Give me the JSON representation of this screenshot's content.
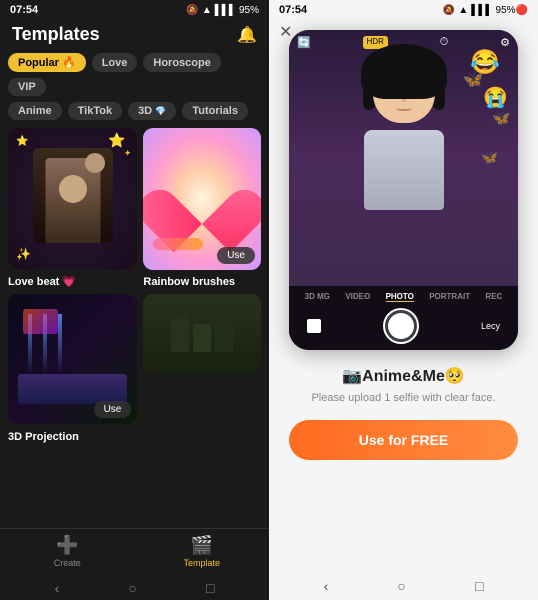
{
  "app": {
    "left_status_time": "07:54",
    "right_status_time": "07:54",
    "battery": "95%"
  },
  "left_panel": {
    "header": {
      "title": "Templates",
      "bell_label": "notifications"
    },
    "tabs_row1": [
      {
        "label": "Popular 🔥",
        "active": true
      },
      {
        "label": "Love",
        "active": false
      },
      {
        "label": "Horoscope",
        "active": false
      },
      {
        "label": "VIP",
        "active": false
      }
    ],
    "tabs_row2": [
      {
        "label": "Anime",
        "active": false
      },
      {
        "label": "TikTok",
        "active": false
      },
      {
        "label": "3D 💎",
        "active": false
      },
      {
        "label": "Tutorials",
        "active": false
      }
    ],
    "cards": [
      {
        "id": "love-beat",
        "title": "Love beat 💗",
        "type": "lovebeat"
      },
      {
        "id": "rainbow-brushes",
        "title": "Rainbow brushes",
        "type": "rainbow",
        "use_label": "Use"
      },
      {
        "id": "3d-projection",
        "title": "3D Projection",
        "type": "3d",
        "use_label": "Use"
      },
      {
        "id": "group",
        "title": "",
        "type": "group"
      }
    ],
    "nav": [
      {
        "icon": "➕",
        "label": "Create",
        "active": false
      },
      {
        "icon": "🎬",
        "label": "Template",
        "active": true
      }
    ]
  },
  "right_panel": {
    "close_icon": "✕",
    "camera_modes": [
      "3D MG",
      "VIDEO",
      "PHOTO",
      "PORTRAIT",
      "REC"
    ],
    "active_mode": "PHOTO",
    "user_label": "Lecy",
    "emojis": [
      "😂",
      "🦋",
      "😭"
    ],
    "modal": {
      "title": "📷Anime&Me🥺",
      "description": "Please upload 1 selfie with clear face.",
      "use_btn_label": "Use for FREE"
    }
  },
  "phone_nav": {
    "back": "‹",
    "home": "○",
    "recent": "□"
  }
}
